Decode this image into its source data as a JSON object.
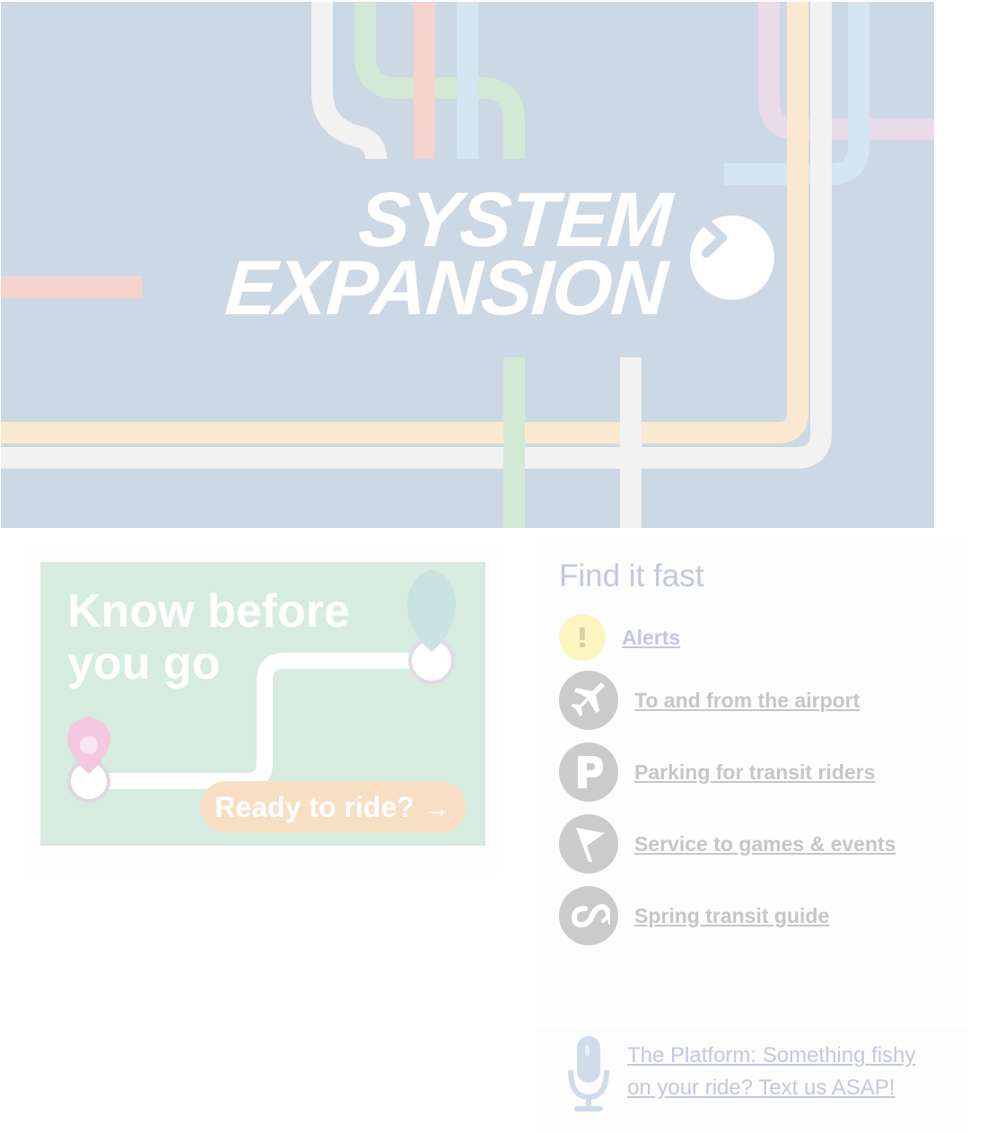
{
  "hero": {
    "title_line1": "SYSTEM",
    "title_line2": "EXPANSION",
    "colors": {
      "background": "#cdd8e5",
      "text": "#ffffff"
    },
    "arrow_icon": "chevron-right-icon"
  },
  "promo": {
    "headline": "Know before you go",
    "cta": "Ready to ride? →",
    "colors": {
      "background": "#d6ece0",
      "cta_background": "#f8dfc4"
    }
  },
  "find_it_fast": {
    "title": "Find it fast",
    "links": [
      {
        "label": "Alerts",
        "icon": "alert-icon"
      },
      {
        "label": "To and from the airport",
        "icon": "airplane-icon"
      },
      {
        "label": "Parking for transit riders",
        "icon": "parking-icon"
      },
      {
        "label": "Service to games & events",
        "icon": "pennant-icon"
      },
      {
        "label": "Spring transit guide",
        "icon": "seasonal-loop-icon"
      }
    ]
  },
  "podcast": {
    "icon": "microphone-icon",
    "link_text": "The Platform: Something fishy on your ride? Text us ASAP!"
  }
}
